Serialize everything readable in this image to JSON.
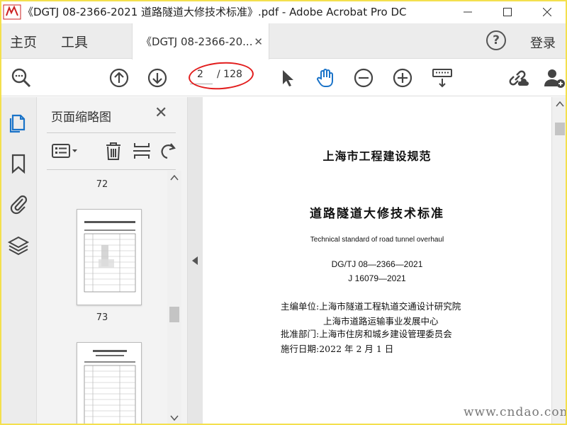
{
  "window": {
    "title": "《DGTJ 08-2366-2021 道路隧道大修技术标准》.pdf - Adobe Acrobat Pro DC"
  },
  "nav": {
    "home": "主页",
    "tools": "工具",
    "tab_label": "《DGTJ 08-2366-20...",
    "login": "登录",
    "help": "?"
  },
  "toolbar": {
    "current_page": "2",
    "total_pages": "/ 128"
  },
  "panel": {
    "title": "页面缩略图",
    "pages": [
      "72",
      "73"
    ]
  },
  "document": {
    "org": "上海市工程建设规范",
    "title": "道路隧道大修技术标准",
    "title_en": "Technical standard of road tunnel overhaul",
    "code": "DG/TJ 08—2366—2021",
    "record": "J 16079—2021",
    "info": [
      "主编单位:上海市隧道工程轨道交通设计研究院",
      "上海市道路运输事业发展中心",
      "批准部门:上海市住房和城乡建设管理委员会",
      "施行日期:2022 年 2 月 1 日"
    ]
  },
  "watermark": "www.cndao.com",
  "colors": {
    "accent_blue": "#1a73c8",
    "annotation_red": "#e21d1d",
    "frame_yellow": "#f4e04d"
  }
}
